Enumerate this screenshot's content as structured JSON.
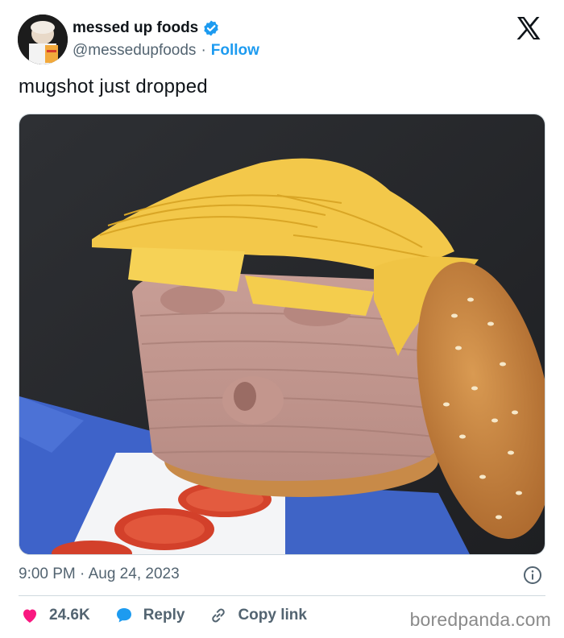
{
  "author": {
    "display_name": "messed up foods",
    "handle": "@messedupfoods",
    "separator": "·",
    "follow_label": "Follow",
    "verified": true
  },
  "tweet": {
    "text": "mugshot just dropped",
    "timestamp": "9:00 PM · Aug 24, 2023"
  },
  "actions": {
    "like_count": "24.6K",
    "reply_label": "Reply",
    "copy_link_label": "Copy link"
  },
  "icons": {
    "verified": "verified-badge-icon",
    "x_logo": "x-logo-icon",
    "info": "info-icon",
    "like": "heart-icon",
    "reply": "speech-bubble-icon",
    "copy_link": "link-icon"
  },
  "colors": {
    "accent_blue": "#1d9bf0",
    "like_red": "#f91880",
    "muted_text": "#536471",
    "text": "#0f1419"
  },
  "watermark": "boredpanda.com"
}
